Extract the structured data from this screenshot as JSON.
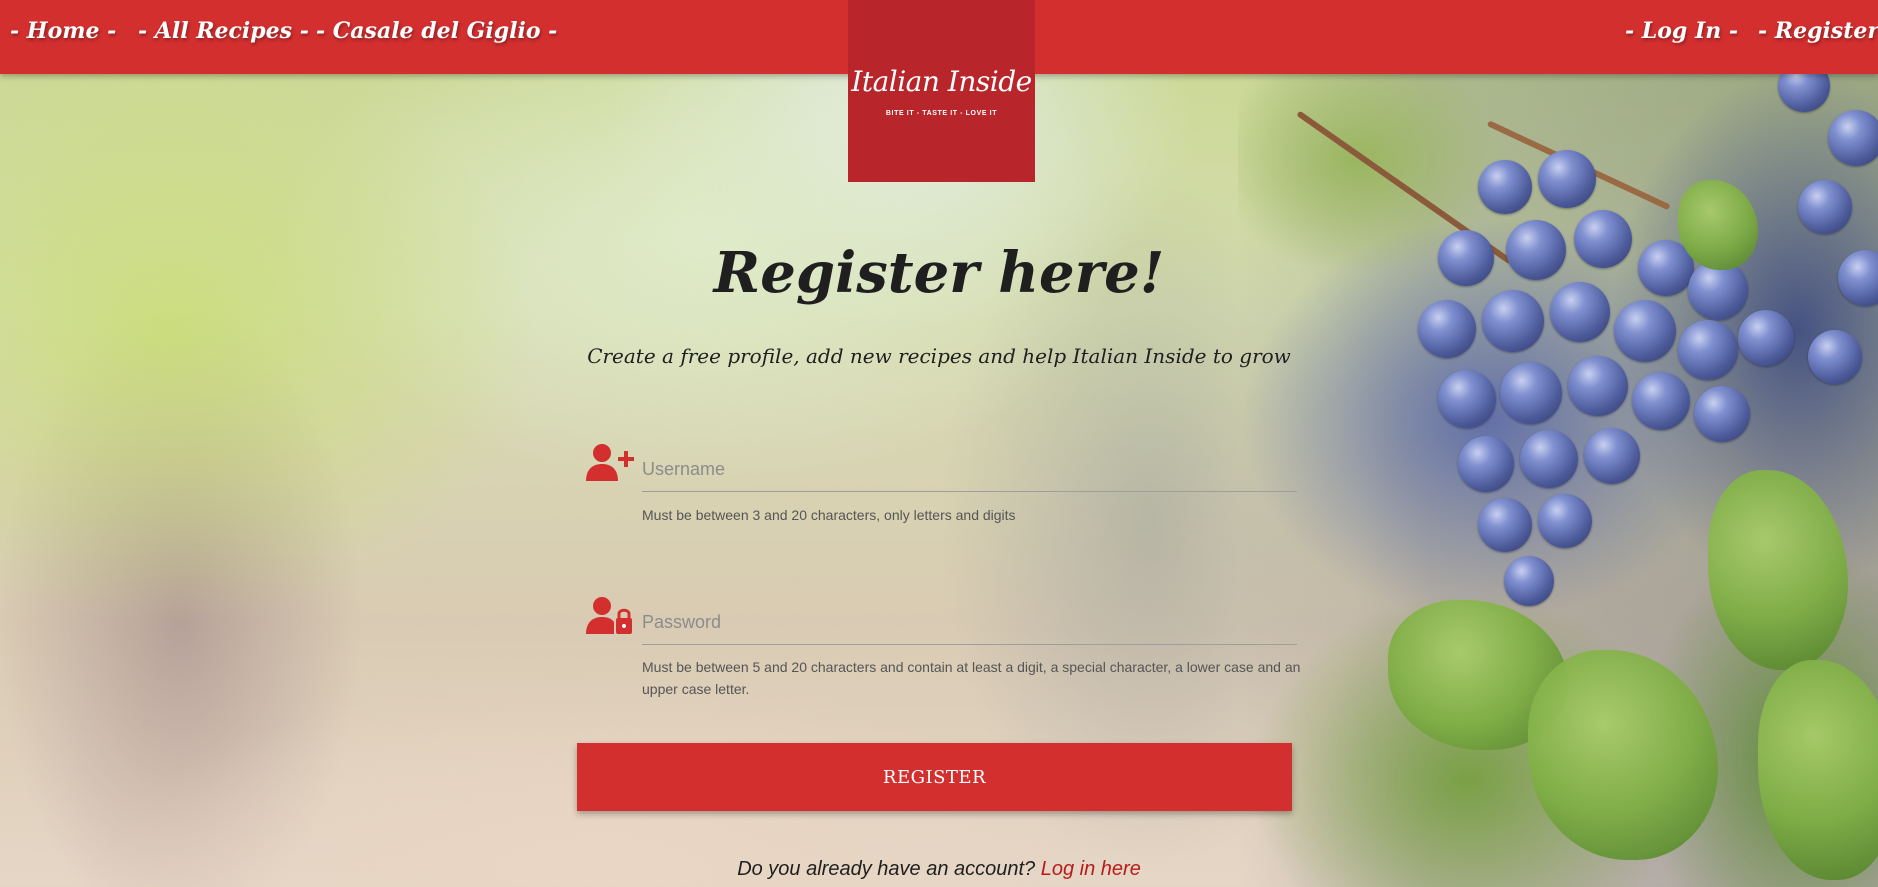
{
  "nav": {
    "home": "- Home -",
    "all_recipes": "- All Recipes -",
    "casale": "- Casale del Giglio -",
    "login": "- Log In -",
    "register": "- Register -"
  },
  "logo": {
    "script": "Italian Inside",
    "tagline": "BITE IT - TASTE IT - LOVE IT"
  },
  "main": {
    "title": "Register here!",
    "subtitle": "Create a free profile, add new recipes and help Italian Inside to grow"
  },
  "form": {
    "username_placeholder": "Username",
    "username_helper": "Must be between 3 and 20 characters, only letters and digits",
    "password_placeholder": "Password",
    "password_helper": "Must be between 5 and 20 characters and contain at least a digit, a special character, a lower case and an upper case letter.",
    "submit_label": "REGISTER"
  },
  "footer": {
    "question": "Do you already have an account? ",
    "login_link": "Log in here"
  },
  "colors": {
    "brand_red": "#d32f2f",
    "logo_red": "#b8262b"
  },
  "icons": {
    "username": "user-plus-icon",
    "password": "user-lock-icon"
  }
}
